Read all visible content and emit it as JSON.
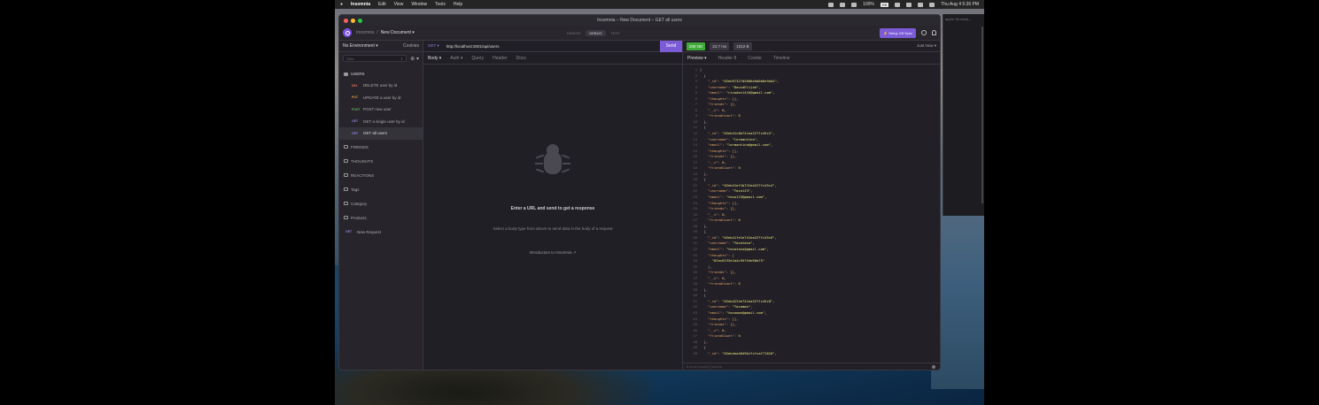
{
  "menubar": {
    "app": "Insomnia",
    "items": [
      "Edit",
      "View",
      "Window",
      "Tools",
      "Help"
    ],
    "battery": "100%",
    "battery_badge": "EB",
    "datetime": "Thu Aug 4  5:36 PM"
  },
  "window": {
    "title": "Insomnia – New Document – GET all users"
  },
  "header": {
    "breadcrumb_root": "Insomnia",
    "breadcrumb_doc": "New Document ▾",
    "modes": [
      "DESIGN",
      "DEBUG",
      "TEST"
    ],
    "setup_sync": "⚡ Setup Git Sync"
  },
  "sidebar": {
    "environment": "No Environment ▾",
    "cookies": "Cookies",
    "filter_placeholder": "Filter",
    "filter_icon": "⇕",
    "add_icon": "⊕ ▾",
    "folders_open": {
      "label": "USERS"
    },
    "requests": [
      {
        "method": "DEL",
        "label": "DELETE user by id"
      },
      {
        "method": "PUT",
        "label": "UPDATE a user by id"
      },
      {
        "method": "POST",
        "label": "POST new user"
      },
      {
        "method": "GET",
        "label": "GET a single user by id"
      },
      {
        "method": "GET",
        "label": "GET all users"
      }
    ],
    "folders": [
      "FRIENDS",
      "THOUGHTS",
      "REACTIONS",
      "Tags",
      "Category",
      "Products"
    ],
    "new_request": {
      "method": "GET",
      "label": "New Request"
    }
  },
  "request": {
    "method": "GET ▾",
    "url": "http://localhost:3001/api/users",
    "send": "Send",
    "tabs": [
      "Body ▾",
      "Auth ▾",
      "Query",
      "Header",
      "Docs"
    ],
    "empty_title": "Enter a URL and send to get a response",
    "empty_sub": "Select a body type from above to send data in the body of a request",
    "empty_link": "Introduction to Insomnia ↗"
  },
  "response": {
    "status": "200 OK",
    "time": "24.7 ms",
    "size": "1012 B",
    "when": "Just Now ▾",
    "tabs": [
      "Preview ▾",
      "Header 8",
      "Cookie",
      "Timeline"
    ],
    "filter_placeholder": "$.store.books[*].author",
    "lines": [
      {
        "n": "1",
        "t": "["
      },
      {
        "n": "2",
        "t": "  {"
      },
      {
        "n": "3",
        "k": "\"_id\"",
        "v": "\"62eb97327d5006e0d0b6e9d44\","
      },
      {
        "n": "4",
        "k": "\"username\"",
        "v": "\"DavidElijah\","
      },
      {
        "n": "5",
        "k": "\"email\"",
        "v": "\"ricodev1416@gmail.com\","
      },
      {
        "n": "6",
        "k": "\"thoughts\"",
        "v": "[],"
      },
      {
        "n": "7",
        "k": "\"friends\"",
        "v": "[],"
      },
      {
        "n": "8",
        "k": "\"__v\"",
        "v": "0,"
      },
      {
        "n": "9",
        "k": "\"friendCount\"",
        "v": "0"
      },
      {
        "n": "10",
        "t": "  },"
      },
      {
        "n": "11",
        "t": "  {"
      },
      {
        "n": "12",
        "k": "\"_id\"",
        "v": "\"62eb41c8b741ea227fc45c2\","
      },
      {
        "n": "13",
        "k": "\"username\"",
        "v": "\"lermantino\","
      },
      {
        "n": "14",
        "k": "\"email\"",
        "v": "\"lermantino@gmail.com\","
      },
      {
        "n": "15",
        "k": "\"thoughts\"",
        "v": "[],"
      },
      {
        "n": "16",
        "k": "\"friends\"",
        "v": "[],"
      },
      {
        "n": "17",
        "k": "\"__v\"",
        "v": "0,"
      },
      {
        "n": "18",
        "k": "\"friendCount\"",
        "v": "0"
      },
      {
        "n": "19",
        "t": "  },"
      },
      {
        "n": "20",
        "t": "  {"
      },
      {
        "n": "21",
        "k": "\"_id\"",
        "v": "\"62eb41ef1b741ea227fc45c4\","
      },
      {
        "n": "22",
        "k": "\"username\"",
        "v": "\"Taco123\","
      },
      {
        "n": "23",
        "k": "\"email\"",
        "v": "\"taco123@gmail.com\","
      },
      {
        "n": "24",
        "k": "\"thoughts\"",
        "v": "[],"
      },
      {
        "n": "25",
        "k": "\"friends\"",
        "v": "[],"
      },
      {
        "n": "26",
        "k": "\"__v\"",
        "v": "0,"
      },
      {
        "n": "27",
        "k": "\"friendCount\"",
        "v": "0"
      },
      {
        "n": "28",
        "t": "  },"
      },
      {
        "n": "29",
        "t": "  {"
      },
      {
        "n": "30",
        "k": "\"_id\"",
        "v": "\"62eb41fe1e741ea227fc45c6\","
      },
      {
        "n": "31",
        "k": "\"username\"",
        "v": "\"Tacotaco\","
      },
      {
        "n": "32",
        "k": "\"email\"",
        "v": "\"tacotaco@gmail.com\","
      },
      {
        "n": "33",
        "k": "\"thoughts\"",
        "v": "["
      },
      {
        "n": "34",
        "t": "      \"62ec6233e1a4c95f54e96a75\""
      },
      {
        "n": "35",
        "t": "    ],"
      },
      {
        "n": "36",
        "k": "\"friends\"",
        "v": "[],"
      },
      {
        "n": "37",
        "k": "\"__v\"",
        "v": "0,"
      },
      {
        "n": "38",
        "k": "\"friendCount\"",
        "v": "0"
      },
      {
        "n": "39",
        "t": "  },"
      },
      {
        "n": "40",
        "t": "  {"
      },
      {
        "n": "41",
        "k": "\"_id\"",
        "v": "\"62eb4224e741ea227fc45c8\","
      },
      {
        "n": "42",
        "k": "\"username\"",
        "v": "\"Tacoman\","
      },
      {
        "n": "43",
        "k": "\"email\"",
        "v": "\"tacoman@gmail.com\","
      },
      {
        "n": "44",
        "k": "\"thoughts\"",
        "v": "[],"
      },
      {
        "n": "45",
        "k": "\"friends\"",
        "v": "[],"
      },
      {
        "n": "46",
        "k": "\"__v\"",
        "v": "0,"
      },
      {
        "n": "47",
        "k": "\"friendCount\"",
        "v": "0"
      },
      {
        "n": "48",
        "t": "  },"
      },
      {
        "n": "49",
        "t": "  {"
      },
      {
        "n": "50",
        "k": "\"_id\"",
        "v": "\"62eb4ea4049b1fcfcaf71816\","
      }
    ]
  },
  "bg_window": {
    "title": "apple-Terminal..."
  },
  "colors": {
    "accent": "#7b5bd6",
    "status_ok": "#3fa93a"
  }
}
